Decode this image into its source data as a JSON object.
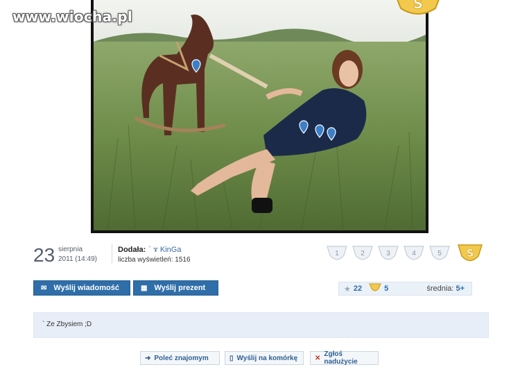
{
  "watermark": "www.wiocha.pl",
  "post": {
    "day": "23",
    "month": "sierpnia",
    "time": "2011 (14:49)",
    "added_label": "Dodała:",
    "author": "` ɤ KinGa",
    "views_label": "liczba wyświetleń:",
    "views": "1516"
  },
  "rating": {
    "options": [
      "1",
      "2",
      "3",
      "4",
      "5"
    ],
    "special_icon": "gold-s-shield-icon"
  },
  "buttons": {
    "message": "Wyślij wiadomość",
    "gift": "Wyślij prezent"
  },
  "score": {
    "stars": "22",
    "shields": "5",
    "average_label": "średnia:",
    "average": "5+"
  },
  "comment": "` Ze Zbysiem ;D",
  "actions": {
    "recommend": "Poleć znajomym",
    "send_mobile": "Wyślij na komórkę",
    "report": "Zgłoś nadużycie"
  },
  "colors": {
    "accent": "#2f6ea8",
    "panel": "#e7eef7",
    "gold": "#e8b422"
  }
}
